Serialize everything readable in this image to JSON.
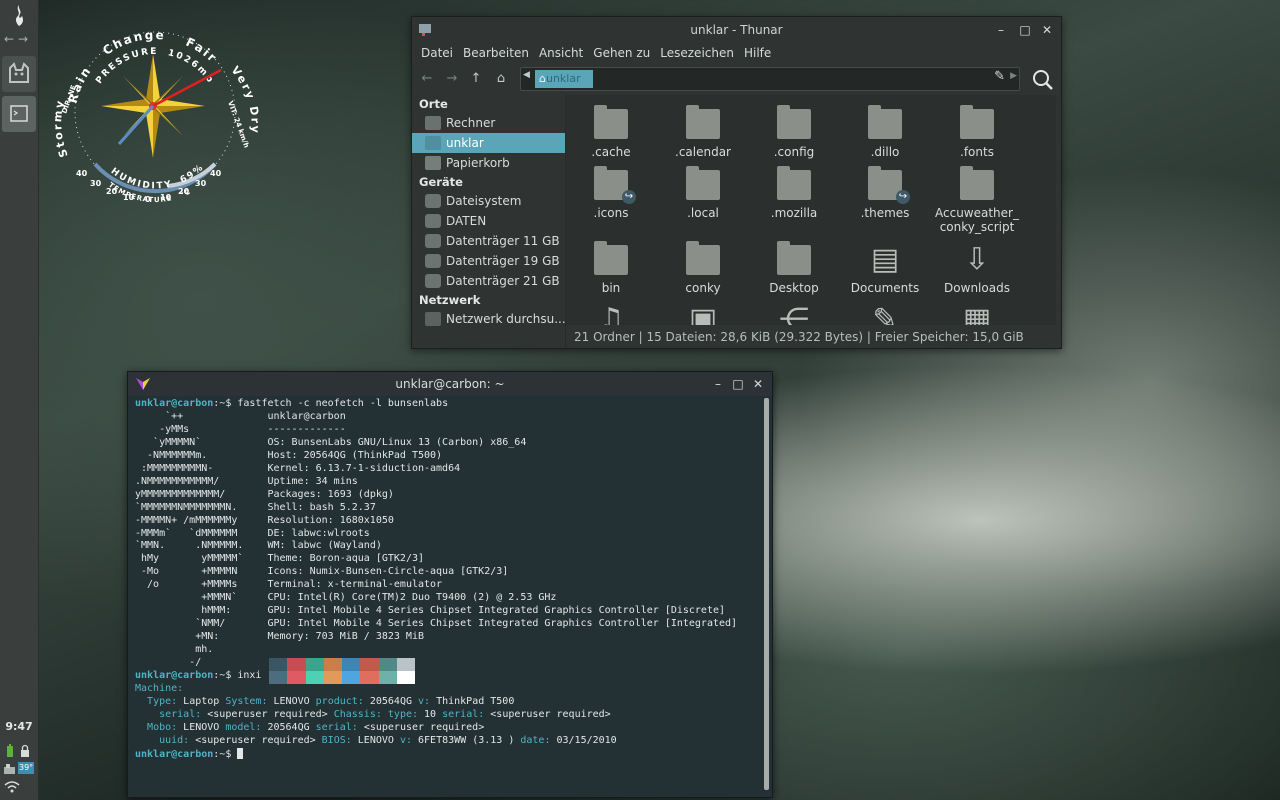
{
  "panel": {
    "clock": "9:47",
    "temp_badge": "39°"
  },
  "conky": {
    "words": [
      "Rain",
      "Change",
      "Fair",
      "Stormy",
      "Very Dry"
    ],
    "pressure_label": "PRESSURE",
    "pressure_value": "1026mb",
    "humidity_label": "HUMIDITY",
    "humidity_value": "69%",
    "temperature_label": "TEMPERATURE",
    "temperature_unit": "°C",
    "dir_label": "DIR: NE",
    "vit_label": "VIT: 24 km/h",
    "temp_scale": [
      "40",
      "30",
      "20",
      "10",
      "0",
      "10",
      "20",
      "30",
      "40"
    ]
  },
  "thunar": {
    "title": "unklar - Thunar",
    "menu": [
      "Datei",
      "Bearbeiten",
      "Ansicht",
      "Gehen zu",
      "Lesezeichen",
      "Hilfe"
    ],
    "crumb": "unklar",
    "sidebar": [
      {
        "type": "header",
        "label": "Orte"
      },
      {
        "type": "item",
        "label": "Rechner",
        "icon": "computer-icon"
      },
      {
        "type": "item",
        "label": "unklar",
        "icon": "home-icon",
        "selected": true
      },
      {
        "type": "item",
        "label": "Papierkorb",
        "icon": "trash-icon"
      },
      {
        "type": "header",
        "label": "Geräte"
      },
      {
        "type": "item",
        "label": "Dateisystem",
        "icon": "drive-icon"
      },
      {
        "type": "item",
        "label": "DATEN",
        "icon": "drive-icon"
      },
      {
        "type": "item",
        "label": "Datenträger 11 GB",
        "icon": "drive-icon"
      },
      {
        "type": "item",
        "label": "Datenträger 19 GB",
        "icon": "drive-icon"
      },
      {
        "type": "item",
        "label": "Datenträger 21 GB",
        "icon": "drive-icon"
      },
      {
        "type": "header",
        "label": "Netzwerk"
      },
      {
        "type": "item",
        "label": "Netzwerk durchsu...",
        "icon": "network-icon"
      }
    ],
    "files": [
      {
        "name": ".cache",
        "icon": "folder-icon"
      },
      {
        "name": ".calendar",
        "icon": "folder-icon"
      },
      {
        "name": ".config",
        "icon": "folder-icon"
      },
      {
        "name": ".dillo",
        "icon": "folder-icon"
      },
      {
        "name": ".fonts",
        "icon": "folder-icon"
      },
      {
        "name": ".icons",
        "icon": "folder-link-icon"
      },
      {
        "name": ".local",
        "icon": "folder-icon"
      },
      {
        "name": ".mozilla",
        "icon": "folder-icon"
      },
      {
        "name": ".themes",
        "icon": "folder-link-icon"
      },
      {
        "name": "Accuweather_conky_script",
        "icon": "folder-icon"
      },
      {
        "name": "bin",
        "icon": "folder-icon"
      },
      {
        "name": "conky",
        "icon": "folder-icon"
      },
      {
        "name": "Desktop",
        "icon": "folder-icon"
      },
      {
        "name": "Documents",
        "icon": "documents-icon"
      },
      {
        "name": "Downloads",
        "icon": "downloads-icon"
      },
      {
        "name": "",
        "icon": "music-icon"
      },
      {
        "name": "",
        "icon": "pictures-icon"
      },
      {
        "name": "",
        "icon": "share-icon"
      },
      {
        "name": "",
        "icon": "templates-icon"
      },
      {
        "name": "",
        "icon": "videos-icon"
      }
    ],
    "status": "21 Ordner  |  15 Dateien: 28,6 KiB (29.322 Bytes)  |  Freier Speicher: 15,0 GiB"
  },
  "terminal": {
    "title": "unklar@carbon: ~",
    "prompt_user": "unklar@carbon",
    "prompt_path": ":~$ ",
    "cmd1": "fastfetch -c neofetch -l bunsenlabs",
    "logo": [
      "     `++      ",
      "    -yMMs     ",
      "   `yMMMMN`   ",
      "  -NMMMMMMm.  ",
      " :MMMMMMMMMN- ",
      ".NMMMMMMMMMMM/",
      "yMMMMMMMMMMMMM/",
      "`MMMMMMNMMMMMMMN.",
      "-MMMMN+ /mMMMMMMy",
      "-MMMm`   `dMMMMMM",
      "`MMN.     .NMMMMM.",
      " hMy       yMMMMM`",
      " -Mo       +MMMMN",
      "  /o       +MMMMs",
      "           +MMMN`",
      "           hMMM:",
      "          `NMM/",
      "          +MN:",
      "          mh.",
      "         -/"
    ],
    "info": [
      {
        "k": "",
        "v": "unklar@carbon"
      },
      {
        "k": "",
        "v": "-------------"
      },
      {
        "k": "OS",
        "v": "BunsenLabs GNU/Linux 13 (Carbon) x86_64"
      },
      {
        "k": "Host",
        "v": "20564QG (ThinkPad T500)"
      },
      {
        "k": "Kernel",
        "v": "6.13.7-1-siduction-amd64"
      },
      {
        "k": "Uptime",
        "v": "34 mins"
      },
      {
        "k": "Packages",
        "v": "1693 (dpkg)"
      },
      {
        "k": "Shell",
        "v": "bash 5.2.37"
      },
      {
        "k": "Resolution",
        "v": "1680x1050"
      },
      {
        "k": "DE",
        "v": "labwc:wlroots"
      },
      {
        "k": "WM",
        "v": "labwc (Wayland)"
      },
      {
        "k": "Theme",
        "v": "Boron-aqua [GTK2/3]"
      },
      {
        "k": "Icons",
        "v": "Numix-Bunsen-Circle-aqua [GTK2/3]"
      },
      {
        "k": "Terminal",
        "v": "x-terminal-emulator"
      },
      {
        "k": "CPU",
        "v": "Intel(R) Core(TM)2 Duo T9400 (2) @ 2.53 GHz"
      },
      {
        "k": "GPU",
        "v": "Intel Mobile 4 Series Chipset Integrated Graphics Controller [Discrete]"
      },
      {
        "k": "GPU",
        "v": "Intel Mobile 4 Series Chipset Integrated Graphics Controller [Integrated]"
      },
      {
        "k": "Memory",
        "v": "703 MiB / 3823 MiB"
      }
    ],
    "swatches_top": [
      "#3a5664",
      "#c74d52",
      "#3aa48e",
      "#c97f4a",
      "#3b86b6",
      "#c25a4a",
      "#4f8a86",
      "#b9c3c8"
    ],
    "swatches_bottom": [
      "#4b6d7d",
      "#e05a63",
      "#4fd0b2",
      "#e09a5b",
      "#4fa6de",
      "#e06e5c",
      "#6fb0aa",
      "#ffffff"
    ],
    "cmd2": "inxi -Mxxx",
    "inxi": {
      "machine": "Machine:",
      "l1": [
        [
          "Type:",
          " Laptop "
        ],
        [
          "System:",
          " LENOVO "
        ],
        [
          "product:",
          " 20564QG "
        ],
        [
          "v:",
          " ThinkPad T500"
        ]
      ],
      "l2": [
        [
          "serial:",
          " <superuser required> "
        ],
        [
          "Chassis:",
          " "
        ],
        [
          "type:",
          " 10 "
        ],
        [
          "serial:",
          " <superuser required>"
        ]
      ],
      "l3": [
        [
          "Mobo:",
          " LENOVO "
        ],
        [
          "model:",
          " 20564QG "
        ],
        [
          "serial:",
          " <superuser required>"
        ]
      ],
      "l4": [
        [
          "uuid:",
          " <superuser required> "
        ],
        [
          "BIOS:",
          " LENOVO "
        ],
        [
          "v:",
          " 6FET83WW (3.13 ) "
        ],
        [
          "date:",
          " 03/15/2010"
        ]
      ]
    }
  }
}
